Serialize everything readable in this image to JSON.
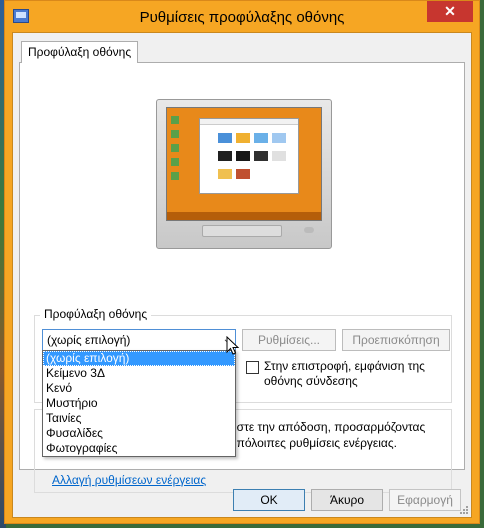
{
  "window": {
    "title": "Ρυθμίσεις προφύλαξης οθόνης",
    "close_glyph": "✕"
  },
  "tab": {
    "label": "Προφύλαξη οθόνης"
  },
  "screensaver": {
    "group_label": "Προφύλαξη οθόνης",
    "selected_value": "(χωρίς επιλογή)",
    "options": [
      "(χωρίς επιλογή)",
      "Κείμενο 3Δ",
      "Κενό",
      "Μυστήριο",
      "Ταινίες",
      "Φυσαλίδες",
      "Φωτογραφίες"
    ],
    "settings_label": "Ρυθμίσεις...",
    "preview_label": "Προεπισκόπηση",
    "resume_text": "Στην επιστροφή, εμφάνιση της οθόνης σύνδεσης",
    "resume_checked": false
  },
  "power": {
    "text_fragment": "ήστε την απόδοση, προσαρμόζοντας υπόλοιπες ρυθμίσεις ενέργειας.",
    "link": "Αλλαγή ρυθμίσεων ενέργειας"
  },
  "buttons": {
    "ok": "OK",
    "cancel": "Άκυρο",
    "apply": "Εφαρμογή"
  },
  "colors": {
    "title_bar": "#f6a623",
    "close_button": "#c7362f",
    "selection": "#3399ff",
    "link": "#0066cc",
    "preview_desktop": "#e8891a"
  }
}
